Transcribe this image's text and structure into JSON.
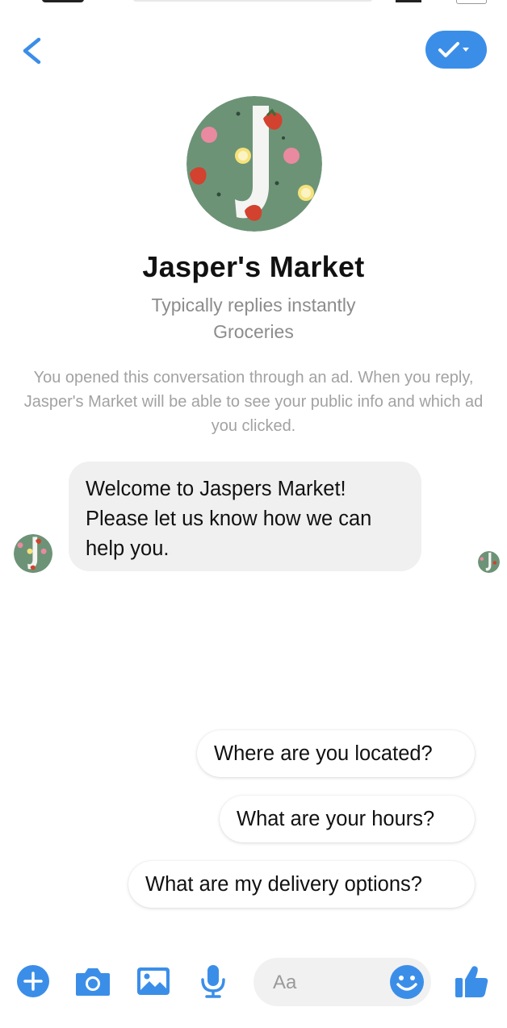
{
  "header": {
    "back_icon": "chevron-left-icon",
    "check_icon": "check-dropdown-icon",
    "accent_color": "#3b8ee8"
  },
  "profile": {
    "name": "Jasper's Market",
    "subtitle": "Typically replies instantly",
    "category": "Groceries",
    "avatar_icon": "jaspers-market-logo"
  },
  "notice": "You opened this conversation through an ad. When you reply, Jasper's Market will be able to see your public info and which ad you clicked.",
  "message": {
    "lines": [
      "Welcome to Jaspers Market!",
      "Please let us know how we can",
      "help you."
    ]
  },
  "quick_replies": [
    "Where are you located?",
    "What are your hours?",
    "What are my delivery options?"
  ],
  "composer": {
    "placeholder": "Aa",
    "icons": [
      "plus-icon",
      "camera-icon",
      "image-icon",
      "microphone-icon",
      "emoji-icon",
      "thumbs-up-icon"
    ]
  }
}
